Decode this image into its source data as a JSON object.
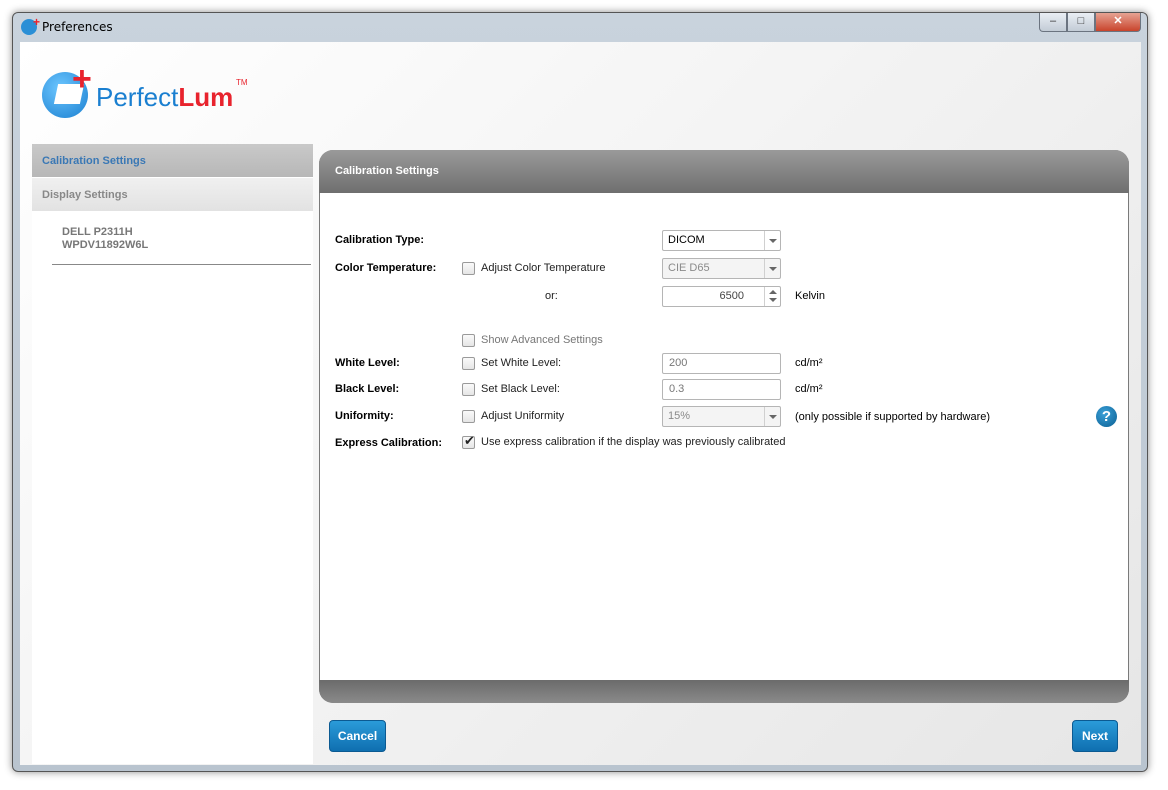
{
  "window": {
    "title": "Preferences"
  },
  "logo": {
    "text_a": "Perfect",
    "text_b": "Lum",
    "tm": "TM"
  },
  "sidebar": {
    "items": [
      {
        "label": "Calibration Settings",
        "active": true
      },
      {
        "label": "Display Settings",
        "active": false
      }
    ],
    "device": {
      "model": "DELL P2311H",
      "serial": "WPDV11892W6L"
    }
  },
  "panel": {
    "title": "Calibration Settings"
  },
  "form": {
    "calibration_type": {
      "label": "Calibration Type:",
      "value": "DICOM"
    },
    "color_temperature": {
      "label": "Color Temperature:",
      "checkbox_label": "Adjust Color Temperature",
      "checked": false,
      "preset_value": "CIE D65",
      "or_label": "or:",
      "kelvin_value": "6500",
      "kelvin_unit": "Kelvin"
    },
    "advanced": {
      "checkbox_label": "Show Advanced Settings",
      "checked": false
    },
    "white_level": {
      "label": "White Level:",
      "checkbox_label": "Set White Level:",
      "checked": false,
      "value": "200",
      "unit": "cd/m²"
    },
    "black_level": {
      "label": "Black Level:",
      "checkbox_label": "Set Black Level:",
      "checked": false,
      "value": "0.3",
      "unit": "cd/m²"
    },
    "uniformity": {
      "label": "Uniformity:",
      "checkbox_label": "Adjust Uniformity",
      "checked": false,
      "value": "15%",
      "note": "(only possible if supported by hardware)"
    },
    "express": {
      "label": "Express Calibration:",
      "checkbox_label": "Use express calibration if the display was previously calibrated",
      "checked": true
    }
  },
  "buttons": {
    "cancel": "Cancel",
    "next": "Next",
    "help": "?"
  },
  "colors": {
    "accent": "#1a7fd0",
    "brand_red": "#e8232d",
    "button_blue": "#1a86c8",
    "active_nav_text": "#3a78b5"
  },
  "icons": {
    "app": "perfectlum-app-icon",
    "help": "question-mark-icon"
  }
}
